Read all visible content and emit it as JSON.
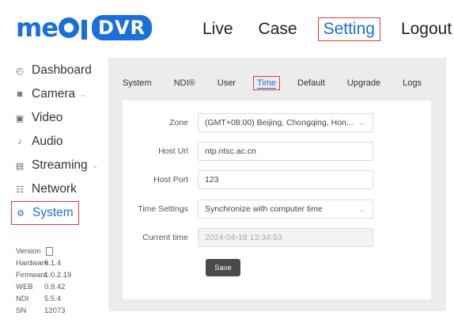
{
  "logo": {
    "brand_left": "me",
    "brand_right": "DVR"
  },
  "topnav": [
    {
      "label": "Live",
      "active": false
    },
    {
      "label": "Case",
      "active": false
    },
    {
      "label": "Setting",
      "active": true
    },
    {
      "label": "Logout",
      "active": false
    }
  ],
  "sidebar": {
    "items": [
      {
        "label": "Dashboard",
        "icon": "dashboard-icon",
        "glyph": "◴",
        "chevron": false,
        "active": false
      },
      {
        "label": "Camera",
        "icon": "camera-icon",
        "glyph": "◙",
        "chevron": true,
        "active": false
      },
      {
        "label": "Video",
        "icon": "video-icon",
        "glyph": "▣",
        "chevron": false,
        "active": false
      },
      {
        "label": "Audio",
        "icon": "audio-icon",
        "glyph": "♪",
        "chevron": false,
        "active": false
      },
      {
        "label": "Streaming",
        "icon": "streaming-icon",
        "glyph": "▤",
        "chevron": true,
        "active": false
      },
      {
        "label": "Network",
        "icon": "network-icon",
        "glyph": "☷",
        "chevron": false,
        "active": false
      },
      {
        "label": "System",
        "icon": "system-icon",
        "glyph": "⚙",
        "chevron": false,
        "active": true
      }
    ]
  },
  "version": {
    "rows": [
      {
        "key": "Version",
        "value": ""
      },
      {
        "key": "Hardware",
        "value": "5.1.4"
      },
      {
        "key": "Firmware",
        "value": "1.0.2.19"
      },
      {
        "key": "WEB",
        "value": "0.9.42"
      },
      {
        "key": "NDI",
        "value": "5.5.4"
      },
      {
        "key": "SN",
        "value": "12073"
      }
    ]
  },
  "tabs": [
    {
      "label": "System",
      "active": false
    },
    {
      "label": "NDI®",
      "active": false
    },
    {
      "label": "User",
      "active": false
    },
    {
      "label": "Time",
      "active": true
    },
    {
      "label": "Default",
      "active": false
    },
    {
      "label": "Upgrade",
      "active": false
    },
    {
      "label": "Logs",
      "active": false
    }
  ],
  "form": {
    "zone": {
      "label": "Zone",
      "value": "(GMT+08:00) Beijing, Chongqing, Hon..."
    },
    "host_url": {
      "label": "Host Url",
      "value": "ntp.ntsc.ac.cn"
    },
    "host_port": {
      "label": "Host Port",
      "value": "123"
    },
    "time_settings": {
      "label": "Time Settings",
      "value": "Synchronize with computer time"
    },
    "current_time": {
      "label": "Current time",
      "value": "2024-04-18 13:34:53"
    },
    "save_label": "Save"
  },
  "colors": {
    "accent": "#1a6fd8",
    "highlight_border": "#e53935",
    "panel_bg": "#ececec"
  }
}
